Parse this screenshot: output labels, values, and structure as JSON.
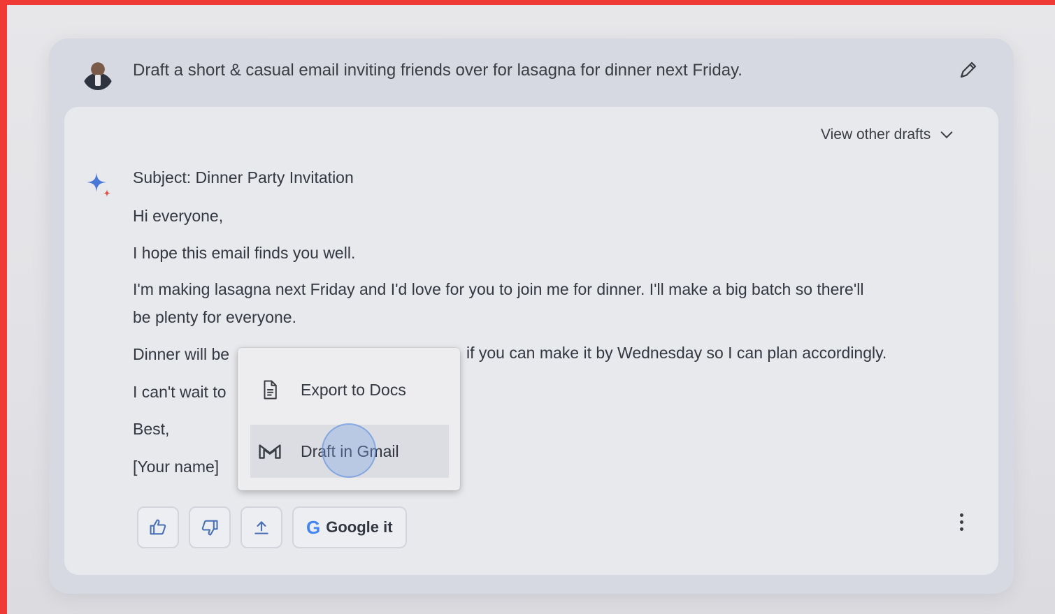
{
  "prompt": {
    "text": "Draft a short & casual email inviting friends over for lasagna for dinner next Friday."
  },
  "response": {
    "view_other_drafts_label": "View other drafts",
    "lines": {
      "subject": "Subject: Dinner Party Invitation",
      "greeting": "Hi everyone,",
      "line1": "I hope this email finds you well.",
      "line2a": "I'm making lasagna next Friday and I'd love for you to join me for dinner. I'll make a big batch so there'll",
      "line2b": "be plenty for everyone.",
      "line3_start": "Dinner will be",
      "line3_end": "if you can make it by Wednesday so I can plan accordingly.",
      "line4_start": "I can't wait to",
      "signoff": "Best,",
      "name": "[Your name]"
    }
  },
  "actions": {
    "thumbs_up_icon": "thumbs-up-icon",
    "thumbs_down_icon": "thumbs-down-icon",
    "share_icon": "share-icon",
    "google_g": "G",
    "google_label": "Google it"
  },
  "export_menu": {
    "items": [
      {
        "label": "Export to Docs",
        "icon": "docs-icon"
      },
      {
        "label": "Draft in Gmail",
        "icon": "gmail-icon"
      }
    ]
  },
  "colors": {
    "frame": "#f03a36",
    "sparkle_blue": "#4a78d8",
    "sparkle_red": "#e0524a"
  }
}
